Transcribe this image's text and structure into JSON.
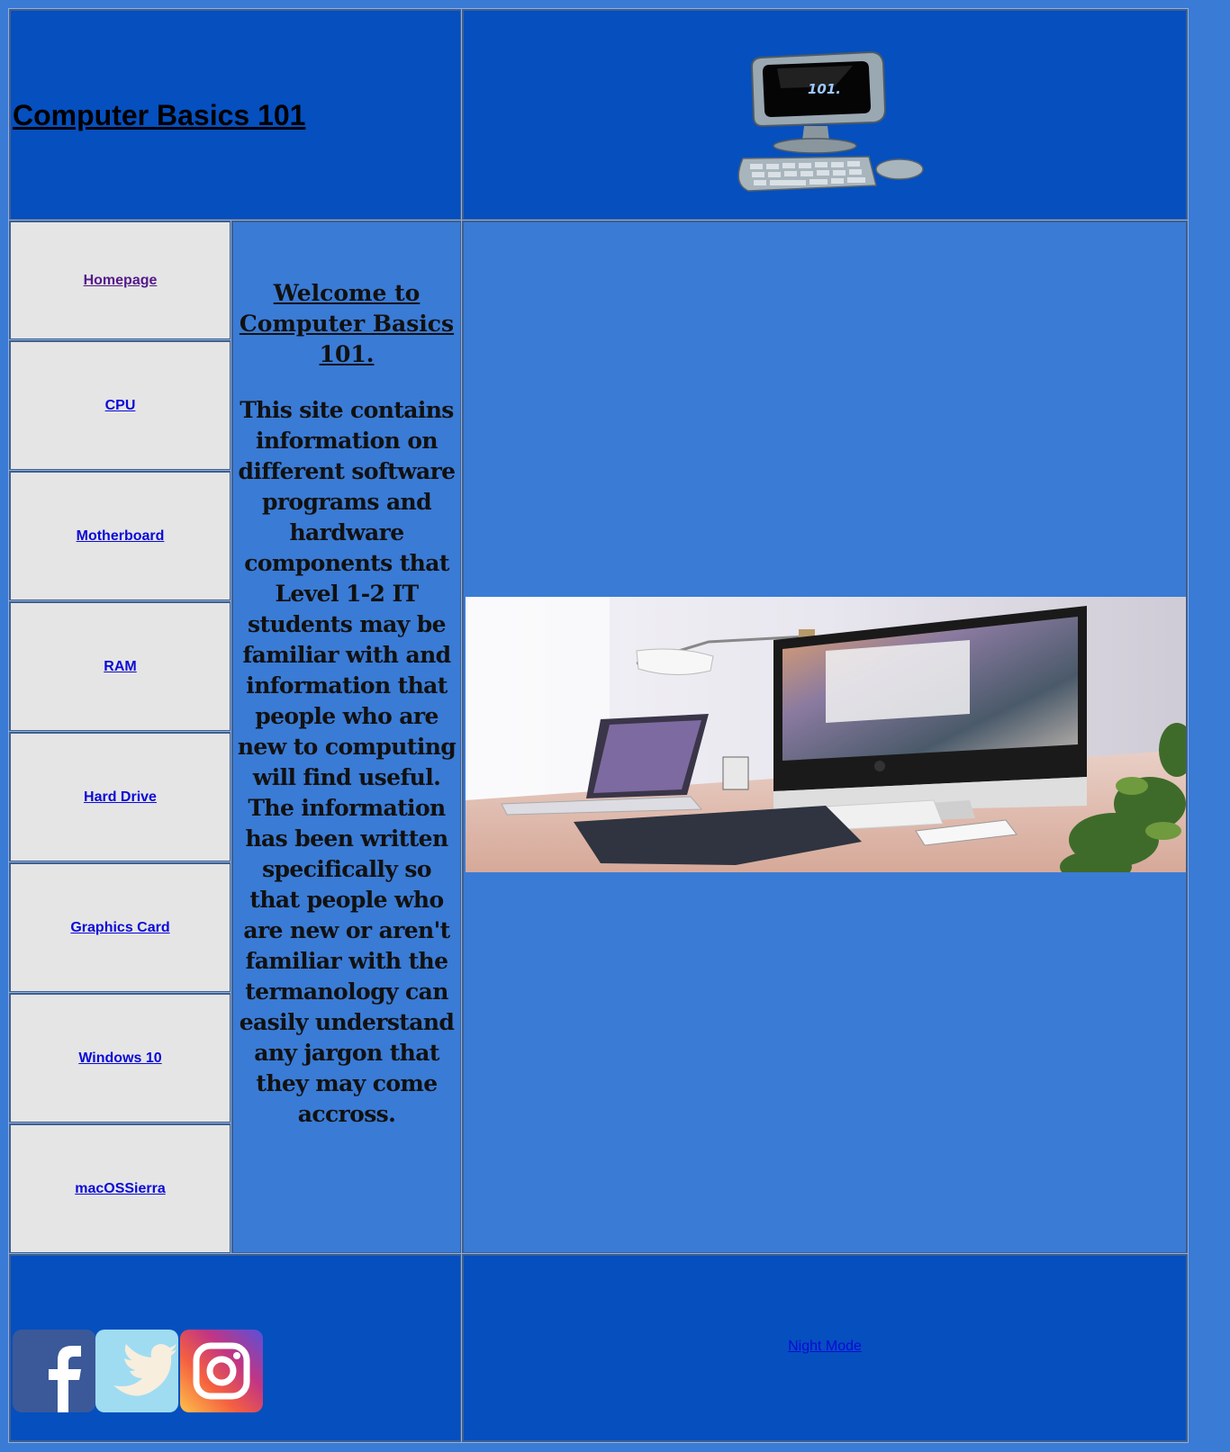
{
  "header": {
    "title": "Computer Basics 101",
    "logo_icon": "computer-101-icon",
    "logo_screen_text": "101."
  },
  "nav": {
    "items": [
      {
        "label": "Homepage"
      },
      {
        "label": "CPU"
      },
      {
        "label": "Motherboard"
      },
      {
        "label": "RAM"
      },
      {
        "label": "Hard Drive"
      },
      {
        "label": "Graphics Card"
      },
      {
        "label": "Windows 10"
      },
      {
        "label": "macOSSierra"
      }
    ]
  },
  "intro": {
    "welcome": "Welcome to Computer Basics 101.",
    "body": "This site contains information on different software programs and hardware components that Level 1-2 IT students may be familiar with and information that people who are new to computing will find useful. The information has been written specifically so that people who are new or aren't familiar with the termanology can easily understand any jargon that they may come accross."
  },
  "hero_image": {
    "icon": "desk-setup-photo"
  },
  "footer": {
    "social": [
      {
        "icon": "facebook-icon"
      },
      {
        "icon": "twitter-icon"
      },
      {
        "icon": "instagram-icon"
      }
    ],
    "night_mode_label": "Night Mode"
  },
  "colors": {
    "page_background": "#3a7bd5",
    "header_footer_background": "#054fbf",
    "nav_background": "#e5e5e5",
    "link": "#0a0ad8",
    "visited_link": "#551a8b"
  }
}
